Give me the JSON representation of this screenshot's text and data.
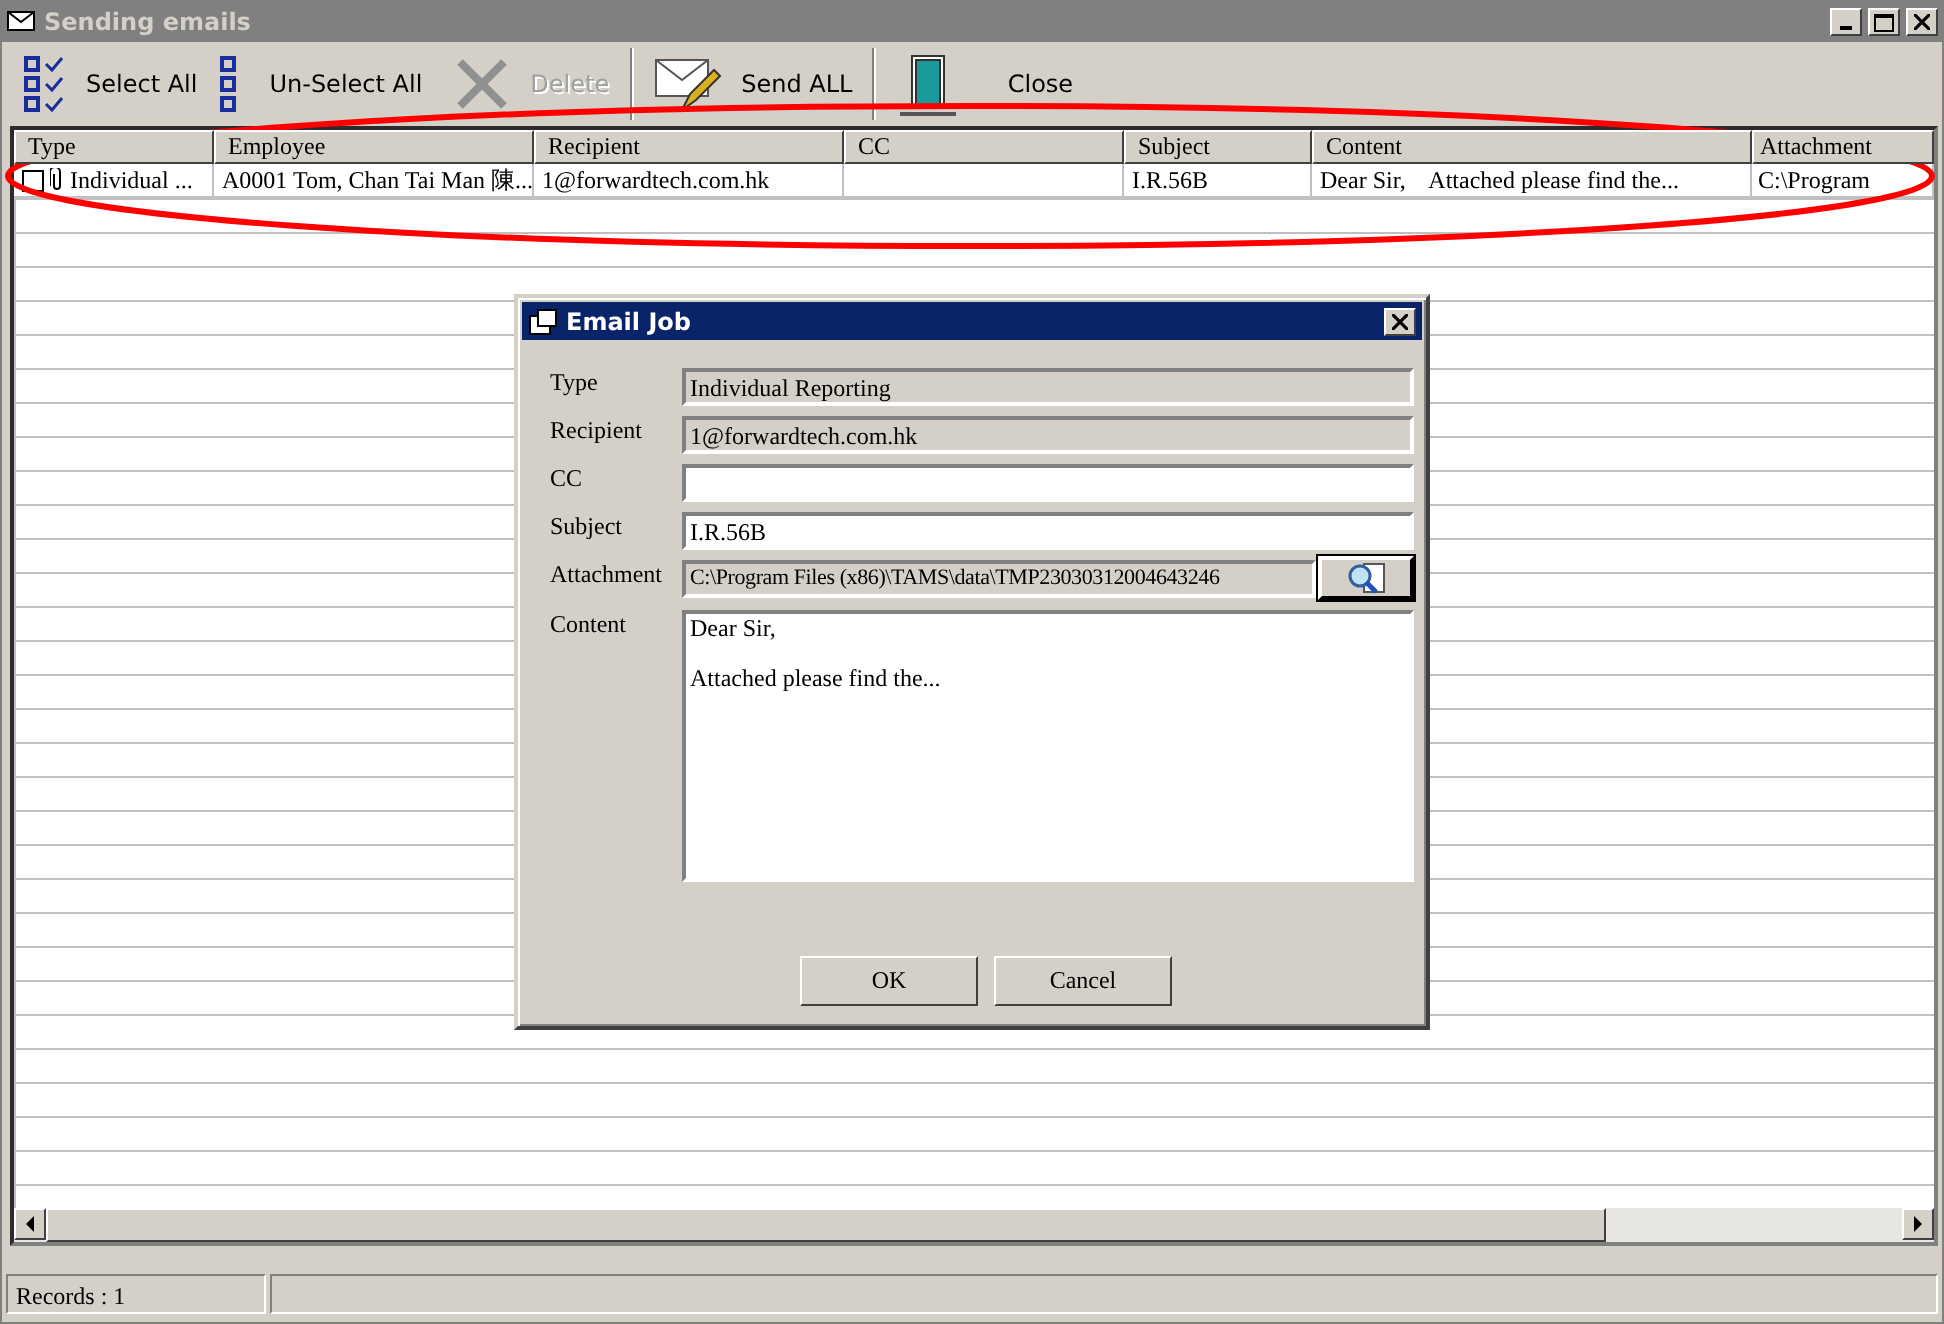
{
  "window": {
    "title": "Sending emails"
  },
  "toolbar": [
    {
      "kind": "select",
      "label": "Select All",
      "disabled": false
    },
    {
      "kind": "unselect",
      "label": "Un-Select All",
      "disabled": false
    },
    {
      "kind": "delete",
      "label": "Delete",
      "disabled": true
    },
    {
      "kind": "send",
      "label": "Send ALL",
      "disabled": false
    },
    {
      "kind": "close",
      "label": "Close",
      "disabled": false
    }
  ],
  "table": {
    "columns": [
      "Type",
      "Employee",
      "Recipient",
      "CC",
      "Subject",
      "Content",
      "Attachment"
    ],
    "rows": [
      {
        "checked": false,
        "cells": [
          "Individual ...",
          "A0001 Tom, Chan Tai Man 陳...",
          "1@forwardtech.com.hk",
          "",
          "I.R.56B",
          "Dear Sir,    Attached please find the...",
          "C:\\Program"
        ]
      }
    ]
  },
  "dialog": {
    "title": "Email Job",
    "fields": [
      {
        "kind": "readonly",
        "label": "Type",
        "value": "Individual Reporting"
      },
      {
        "kind": "readonly",
        "label": "Recipient",
        "value": "1@forwardtech.com.hk"
      },
      {
        "kind": "text",
        "label": "CC"
      },
      {
        "kind": "text",
        "label": "Subject",
        "value": "I.R.56B"
      },
      {
        "kind": "file",
        "label": "Attachment",
        "value": "C:\\Program Files (x86)\\TAMS\\data\\TMP23030312004643246"
      },
      {
        "kind": "memo",
        "label": "Content",
        "lines": [
          "Dear Sir,",
          "Attached please find the..."
        ]
      }
    ],
    "buttons": [
      "OK",
      "Cancel"
    ]
  },
  "status_bar": {
    "records": "Records : 1"
  }
}
